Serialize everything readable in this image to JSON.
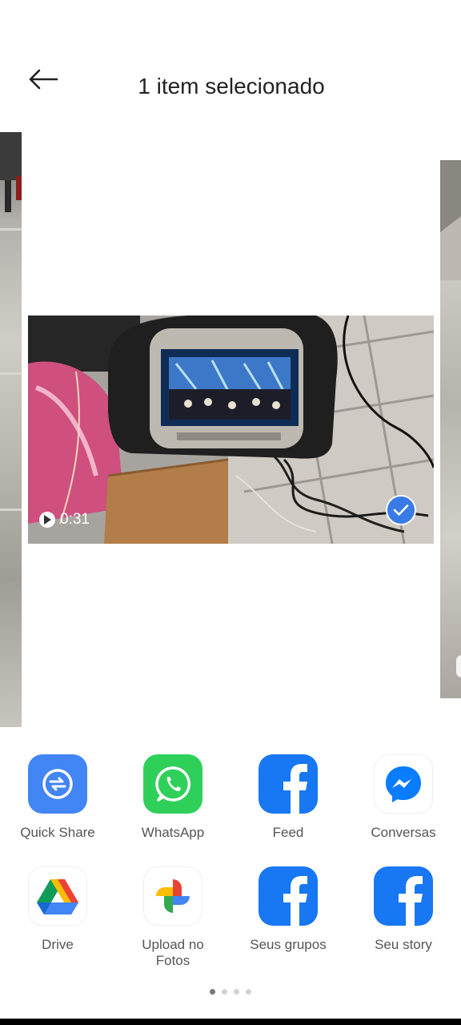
{
  "header": {
    "back_icon": "arrow-left-icon",
    "title": "1 item selecionado"
  },
  "media": {
    "duration": "0:31",
    "selected": true,
    "selected_color": "#3a7ae6"
  },
  "share_apps": [
    {
      "label": "Quick Share",
      "icon": "quick-share-icon",
      "color": "#4285f4"
    },
    {
      "label": "WhatsApp",
      "icon": "whatsapp-icon",
      "color": "#25d366"
    },
    {
      "label": "Feed",
      "icon": "facebook-icon",
      "color": "#1877f2"
    },
    {
      "label": "Conversas",
      "icon": "messenger-icon",
      "color": "#0a7cff"
    },
    {
      "label": "Drive",
      "icon": "google-drive-icon",
      "color": "#ffffff"
    },
    {
      "label": "Upload no\nFotos",
      "icon": "google-photos-icon",
      "color": "#ffffff"
    },
    {
      "label": "Seus grupos",
      "icon": "facebook-icon",
      "color": "#1877f2"
    },
    {
      "label": "Seu story",
      "icon": "facebook-icon",
      "color": "#1877f2"
    }
  ],
  "pager": {
    "pages": 4,
    "current": 1
  }
}
